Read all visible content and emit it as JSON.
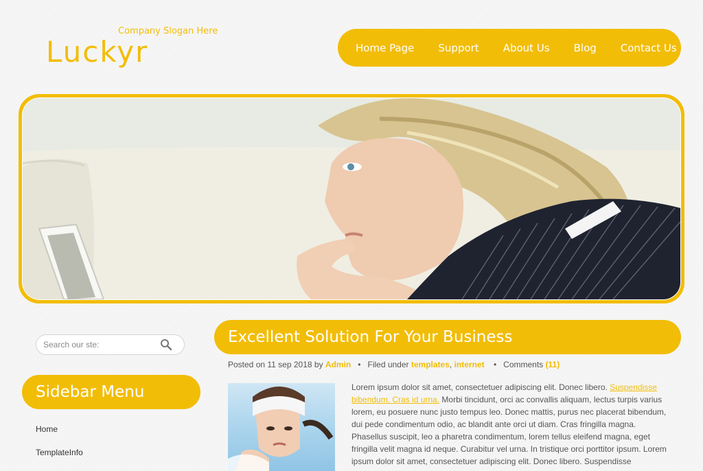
{
  "header": {
    "slogan": "Company Slogan Here",
    "logo": "Luckyr"
  },
  "nav": {
    "items": [
      "Home Page",
      "Support",
      "About Us",
      "Blog",
      "Contact Us"
    ]
  },
  "search": {
    "placeholder": "Search our ste:",
    "icon": "search-icon"
  },
  "sidebar": {
    "title": "Sidebar Menu",
    "items": [
      "Home",
      "TemplateInfo"
    ]
  },
  "post": {
    "title": "Excellent Solution For Your Business",
    "meta": {
      "posted_on": "Posted on 11 sep 2018 by",
      "author": "Admin",
      "bullet": "•",
      "filed_under": "Filed under",
      "tag1": "templates",
      "comma": ",",
      "tag2": "internet",
      "comments_label": "Comments",
      "comments_count": "(11)"
    },
    "body_start": "Lorem ipsum dolor sit amet, consectetuer adipiscing elit. Donec libero.",
    "link": "Suspendisse bibendum. Cras id urna.",
    "body_rest": "Morbi tincidunt, orci ac convallis aliquam, lectus turpis varius lorem, eu posuere nunc justo tempus leo. Donec mattis, purus nec placerat bibendum, dui pede condimentum odio, ac blandit ante orci ut diam. Cras fringilla magna. Phasellus suscipit, leo a pharetra condimentum, lorem tellus eleifend magna, eget fringilla velit magna id neque. Curabitur vel urna. In tristique orci porttitor ipsum. Lorem ipsum dolor sit amet, consectetuer adipiscing elit. Donec libero. Suspendisse"
  },
  "colors": {
    "accent": "#f2bd07",
    "background": "#f6f6f6"
  }
}
